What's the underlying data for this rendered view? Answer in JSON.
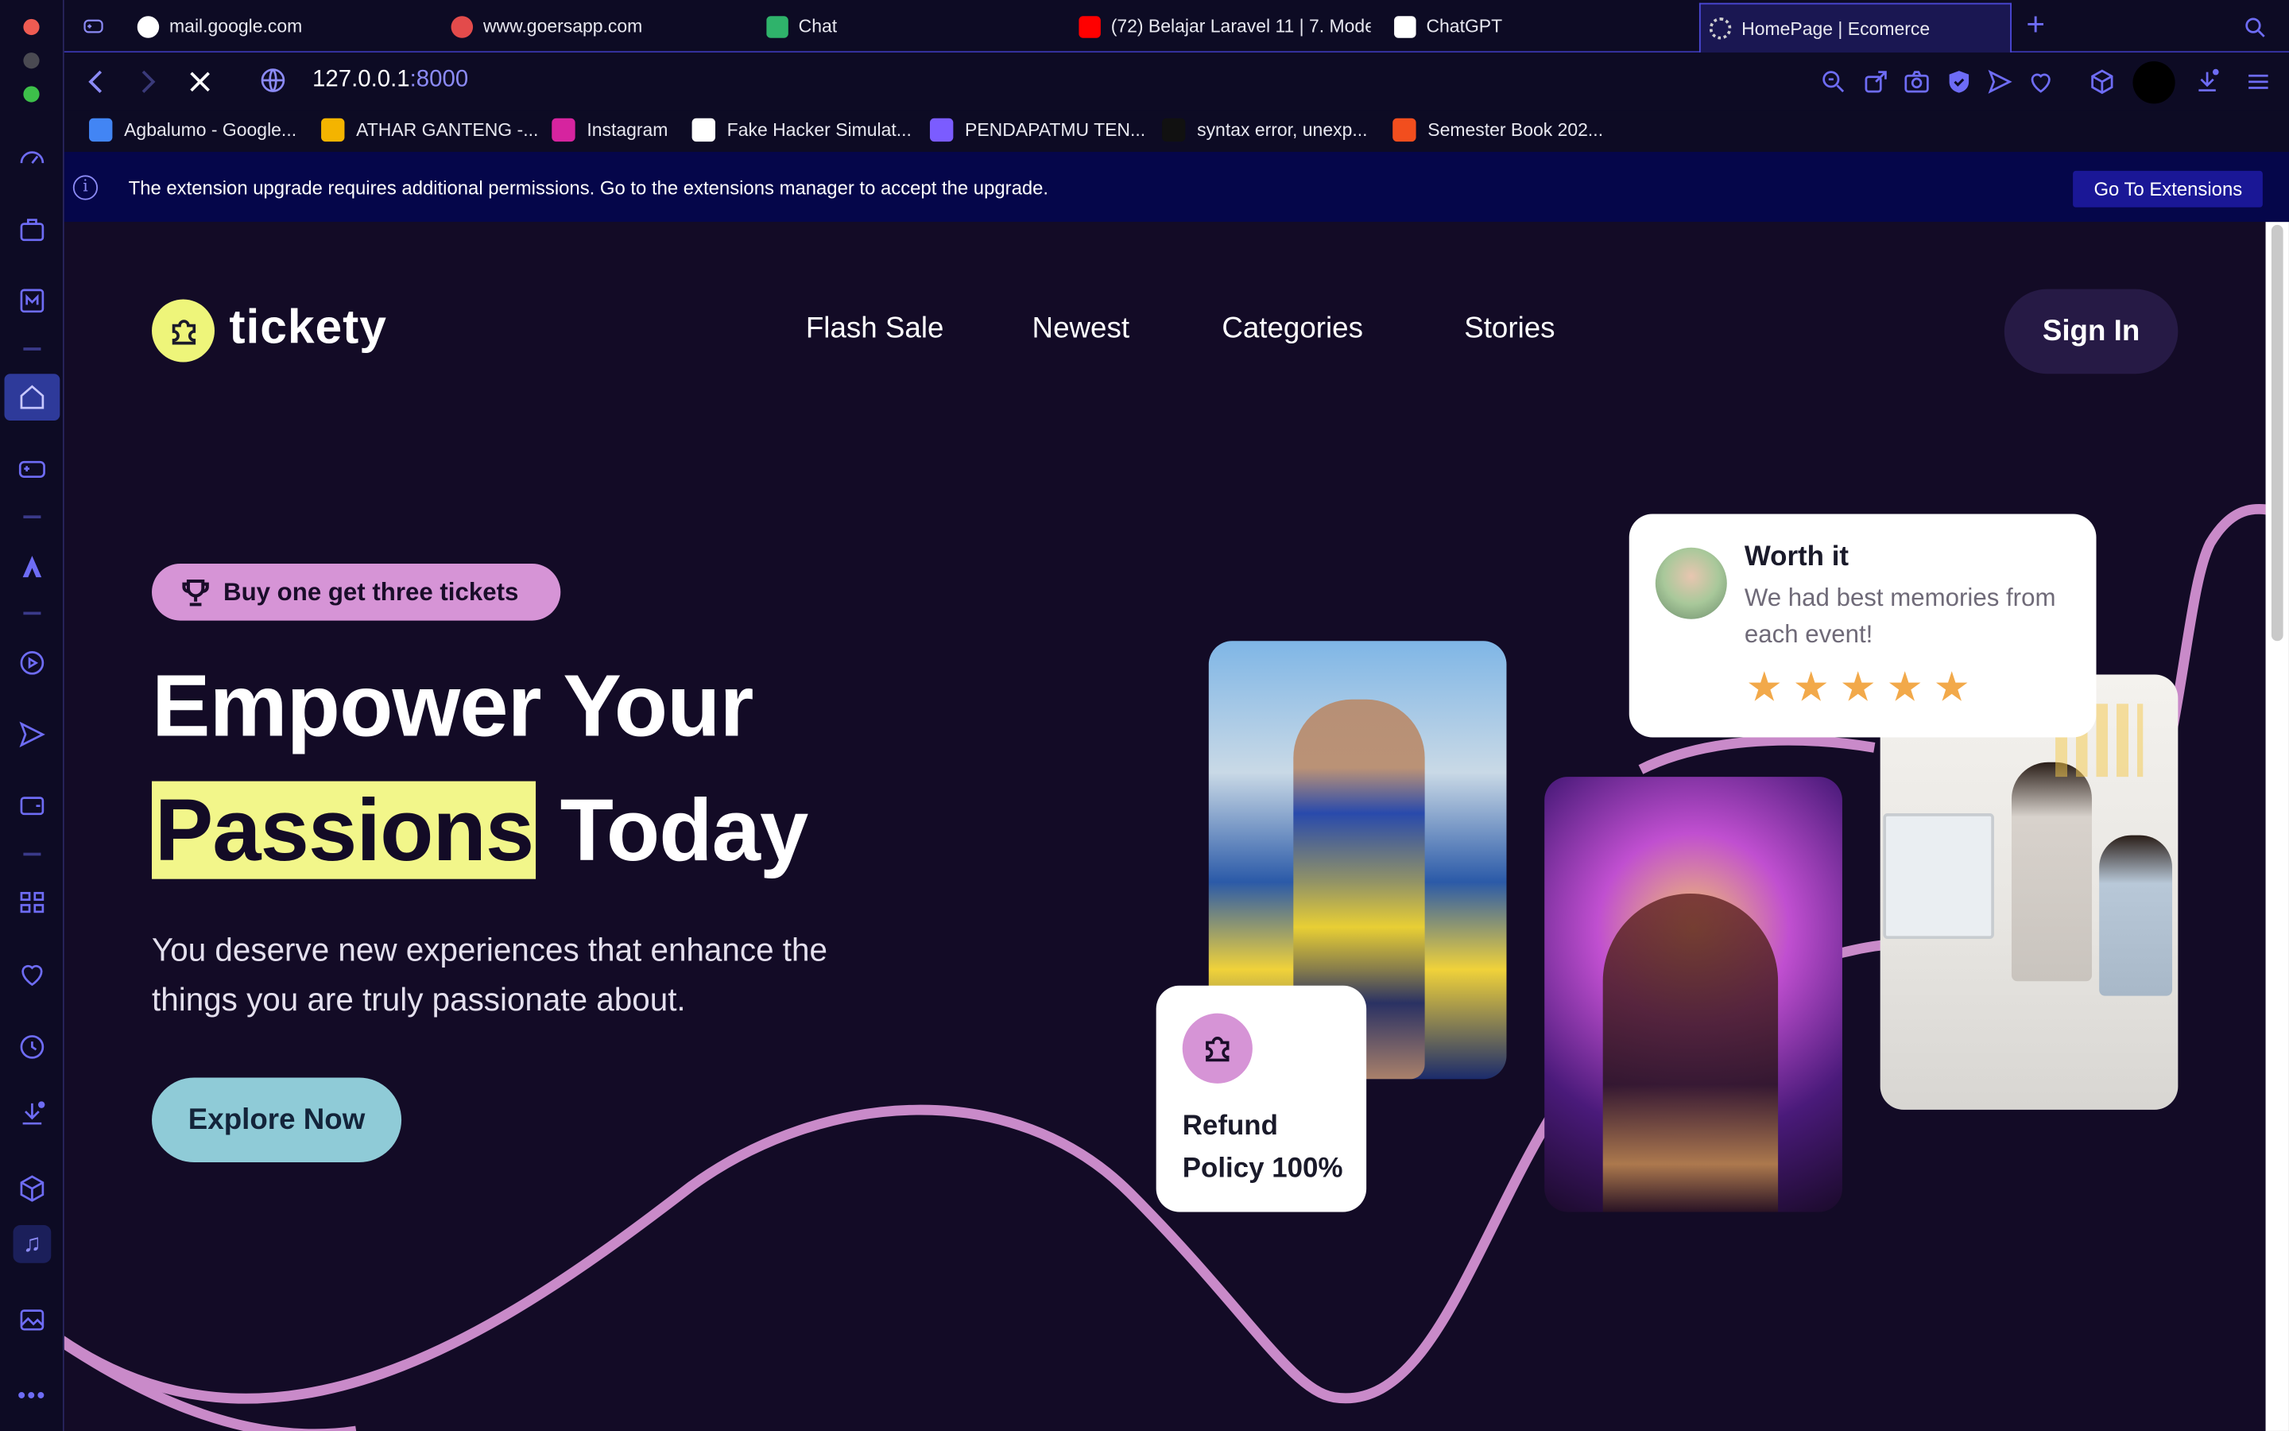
{
  "browser": {
    "tabs": [
      {
        "label": "mail.google.com",
        "color": "#ffffff"
      },
      {
        "label": "www.goersapp.com",
        "color": "#e34b4b"
      },
      {
        "label": "Chat",
        "color": "#2fb36b"
      },
      {
        "label": "(72) Belajar Laravel 11 | 7. Mode",
        "color": "#ff0000"
      },
      {
        "label": "ChatGPT",
        "color": "#ffffff"
      },
      {
        "label": "HomePage | Ecomerce",
        "color": "#cfcfcf"
      }
    ],
    "new_tab": "+",
    "url_host": "127.0.0.1",
    "url_port": ":8000",
    "bookmarks": [
      {
        "label": "Agbalumo - Google...",
        "color": "#4285f4"
      },
      {
        "label": "ATHAR GANTENG -...",
        "color": "#f4b400"
      },
      {
        "label": "Instagram",
        "color": "#d6249f"
      },
      {
        "label": "Fake Hacker Simulat...",
        "color": "#ffffff"
      },
      {
        "label": "PENDAPATMU TEN...",
        "color": "#7b5cff"
      },
      {
        "label": "syntax error, unexp...",
        "color": "#111111"
      },
      {
        "label": "Semester Book 202...",
        "color": "#f24e1e"
      }
    ],
    "infobar": {
      "icon": "i",
      "message": "The extension upgrade requires additional permissions. Go to the extensions manager to accept the upgrade.",
      "button": "Go To Extensions"
    }
  },
  "site": {
    "logo": "tickety",
    "nav": [
      "Flash Sale",
      "Newest",
      "Categories",
      "Stories"
    ],
    "sign_in": "Sign In",
    "promo": "Buy one get three tickets",
    "headline_line1": "Empower Your",
    "headline_highlight": "Passions",
    "headline_rest": "Today",
    "subtitle": "You deserve new experiences that enhance the things you are truly passionate about.",
    "cta": "Explore Now",
    "review": {
      "title": "Worth it",
      "text": "We had best memories from each event!",
      "rating": 5
    },
    "refund": {
      "line1": "Refund",
      "line2": "Policy 100%"
    }
  },
  "colors": {
    "page_bg": "#130b26",
    "accent_yellow": "#f2f68a",
    "accent_pink": "#d694d6",
    "accent_teal": "#8fcbd7",
    "browser_accent": "#6e6cf5"
  }
}
